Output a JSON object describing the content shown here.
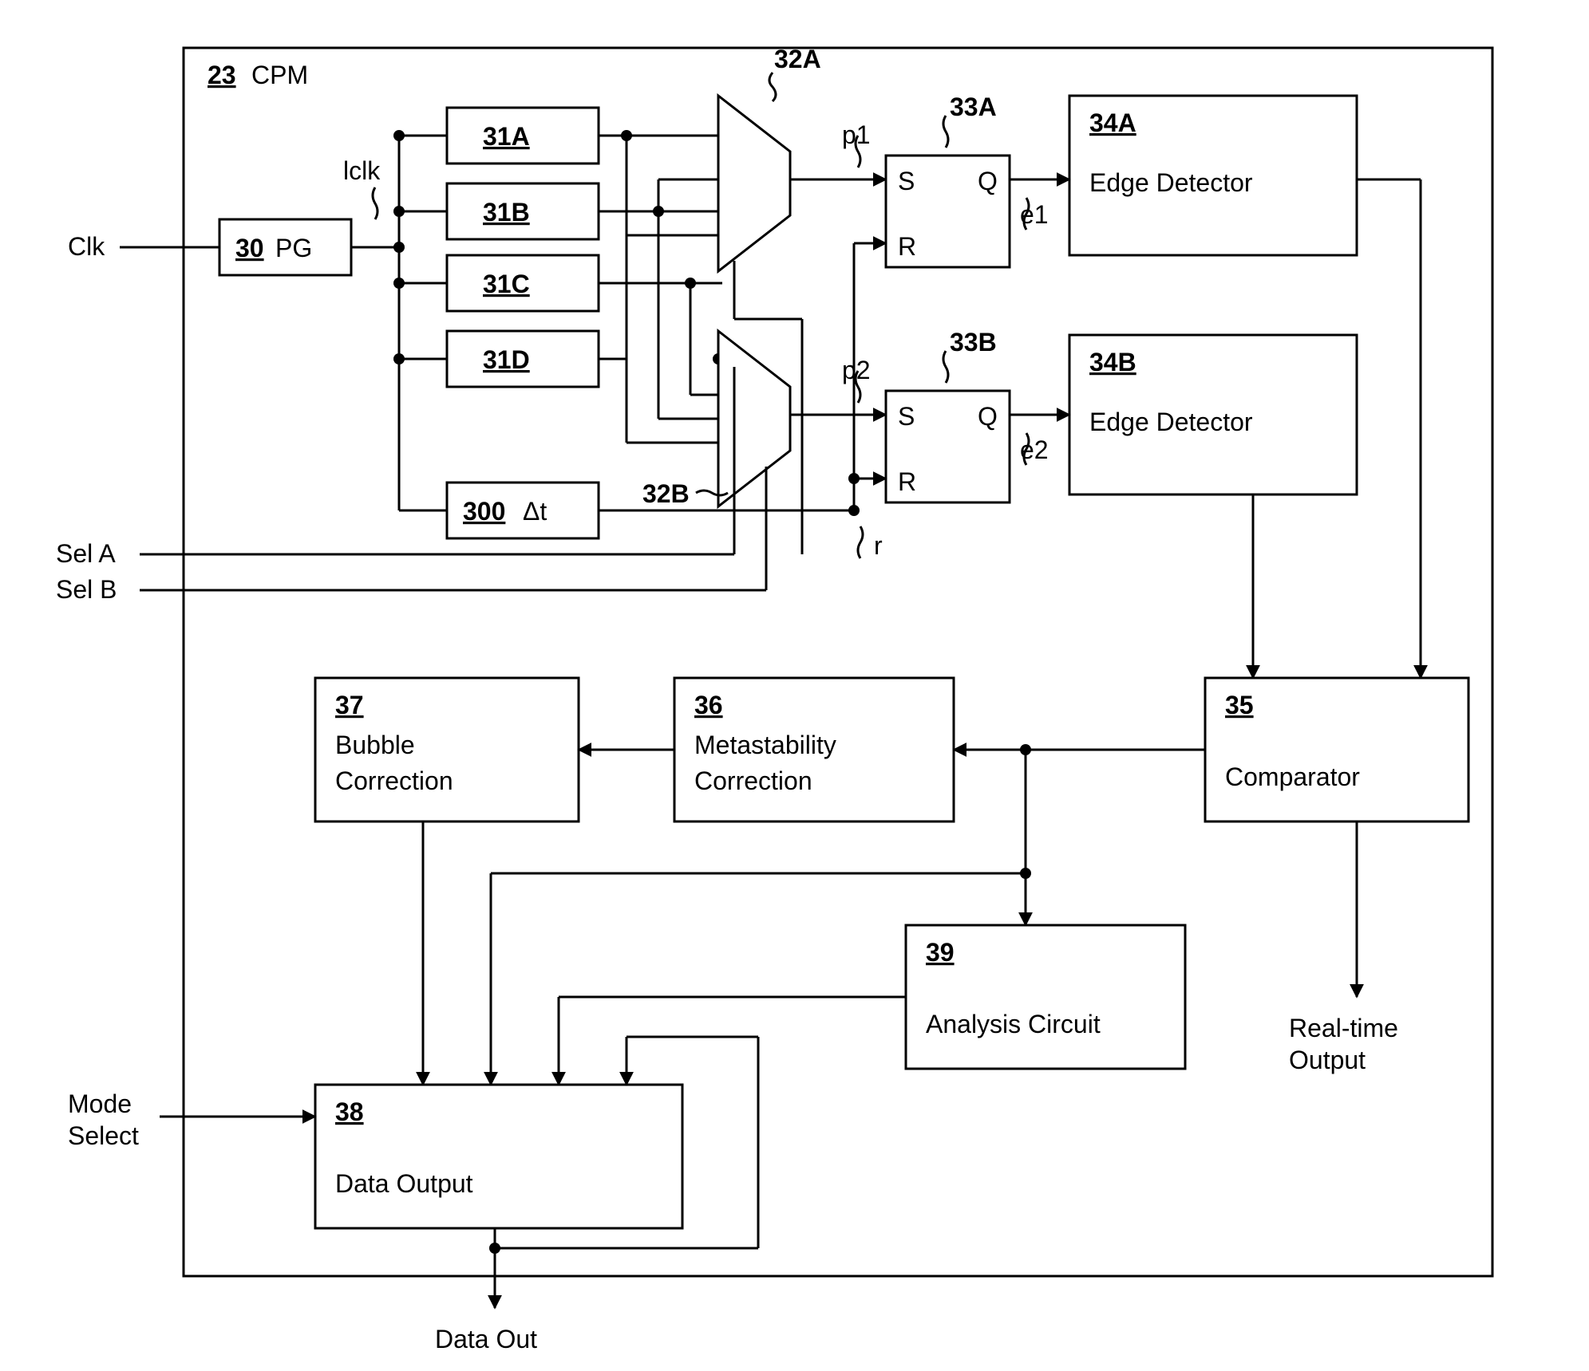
{
  "container": {
    "ref": "23",
    "name": "CPM"
  },
  "inputs": {
    "clk": "Clk",
    "selA": "Sel A",
    "selB": "Sel B",
    "modeSelect1": "Mode",
    "modeSelect2": "Select"
  },
  "outputs": {
    "dataOut": "Data Out",
    "rt1": "Real-time",
    "rt2": "Output"
  },
  "blocks": {
    "pg": {
      "ref": "30",
      "name": "PG"
    },
    "d31a": {
      "ref": "31A"
    },
    "d31b": {
      "ref": "31B"
    },
    "d31c": {
      "ref": "31C"
    },
    "d31d": {
      "ref": "31D"
    },
    "dt": {
      "ref": "300",
      "name": "Δt"
    },
    "muxA": {
      "ref": "32A"
    },
    "muxB": {
      "ref": "32B"
    },
    "latchA": {
      "ref": "33A",
      "S": "S",
      "R": "R",
      "Q": "Q"
    },
    "latchB": {
      "ref": "33B",
      "S": "S",
      "R": "R",
      "Q": "Q"
    },
    "edA": {
      "ref": "34A",
      "name": "Edge Detector"
    },
    "edB": {
      "ref": "34B",
      "name": "Edge Detector"
    },
    "cmp": {
      "ref": "35",
      "name": "Comparator"
    },
    "meta": {
      "ref": "36",
      "name1": "Metastability",
      "name2": "Correction"
    },
    "bubble": {
      "ref": "37",
      "name1": "Bubble",
      "name2": "Correction"
    },
    "dout": {
      "ref": "38",
      "name": "Data Output"
    },
    "anal": {
      "ref": "39",
      "name": "Analysis Circuit"
    }
  },
  "signals": {
    "lclk": "lclk",
    "p1": "p1",
    "p2": "p2",
    "e1": "e1",
    "e2": "e2",
    "r": "r"
  }
}
